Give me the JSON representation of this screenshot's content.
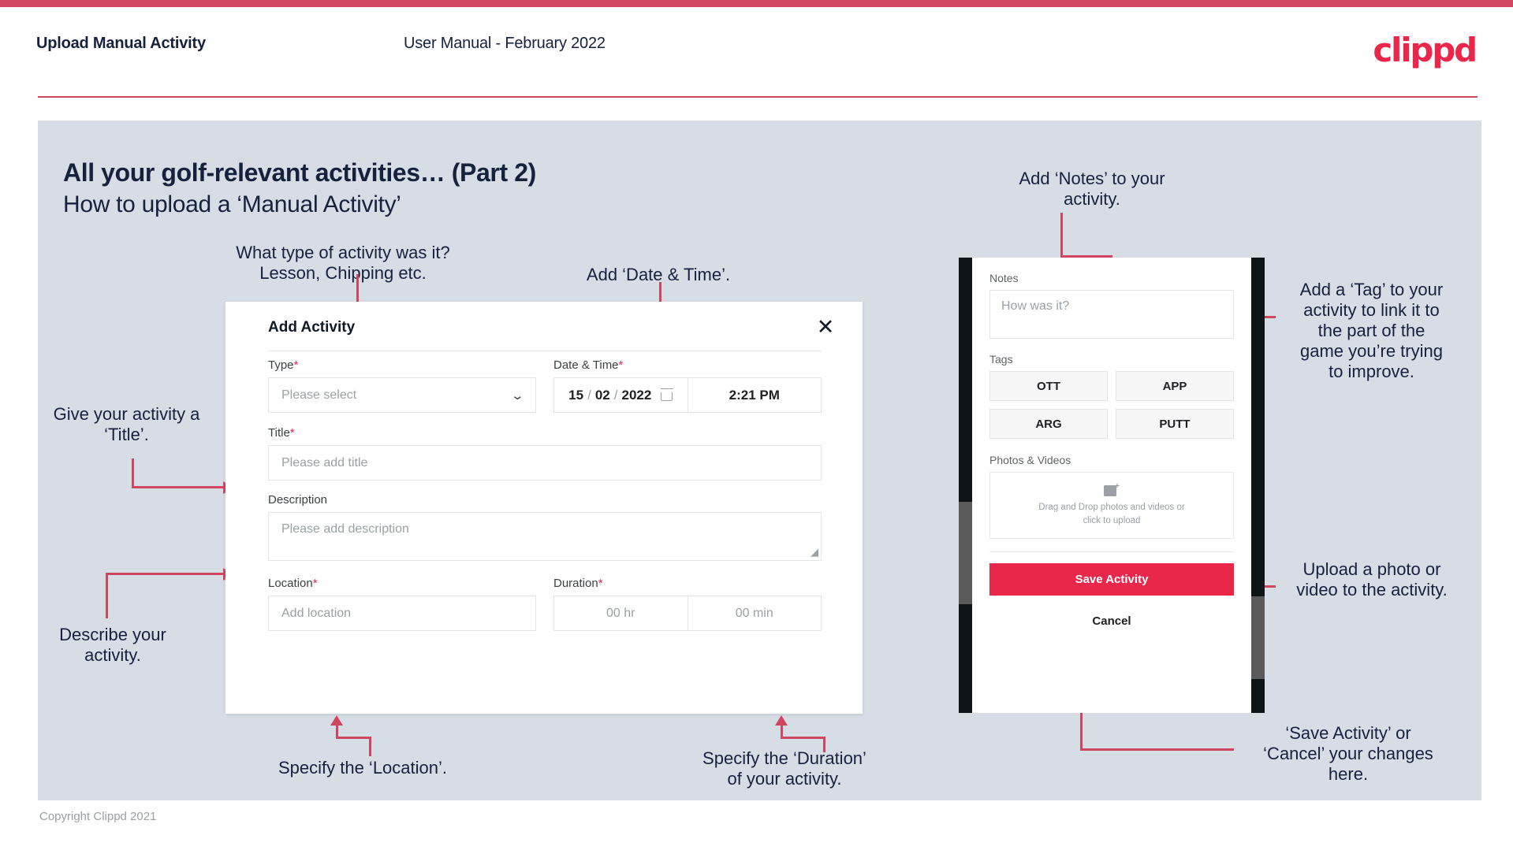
{
  "header": {
    "title": "Upload Manual Activity",
    "subtitle": "User Manual - February 2022",
    "brand": "clippd"
  },
  "slide": {
    "title": "All your golf-relevant activities… (Part 2)",
    "subtitle": "How to upload a ‘Manual Activity’"
  },
  "callouts": {
    "type": "What type of activity was it?\nLesson, Chipping etc.",
    "datetime": "Add ‘Date & Time’.",
    "title": "Give your activity a\n‘Title’.",
    "description": "Describe your\nactivity.",
    "location": "Specify the ‘Location’.",
    "duration": "Specify the ‘Duration’\nof your activity.",
    "notes": "Add ‘Notes’ to your\nactivity.",
    "tags": "Add a ‘Tag’ to your\nactivity to link it to\nthe part of the\ngame you’re trying\nto improve.",
    "upload": "Upload a photo or\nvideo to the activity.",
    "save": "‘Save Activity’ or\n‘Cancel’ your changes\nhere."
  },
  "dialog": {
    "title": "Add Activity",
    "close_icon": "✕",
    "type": {
      "label": "Type",
      "required": "*",
      "placeholder": "Please select",
      "chevron": "⌄"
    },
    "datetime": {
      "label": "Date & Time",
      "required": "*",
      "day": "15",
      "month": "02",
      "year": "2022",
      "sep": "/",
      "time": "2:21 PM"
    },
    "title_field": {
      "label": "Title",
      "required": "*",
      "placeholder": "Please add title"
    },
    "description": {
      "label": "Description",
      "placeholder": "Please add description"
    },
    "location": {
      "label": "Location",
      "required": "*",
      "placeholder": "Add location"
    },
    "duration": {
      "label": "Duration",
      "required": "*",
      "hours": "00 hr",
      "minutes": "00 min"
    }
  },
  "phone": {
    "notes": {
      "label": "Notes",
      "placeholder": "How was it?"
    },
    "tags": {
      "label": "Tags",
      "items": [
        "OTT",
        "APP",
        "ARG",
        "PUTT"
      ]
    },
    "photos": {
      "label": "Photos & Videos",
      "drop_text": "Drag and Drop photos and videos or click to upload"
    },
    "save_label": "Save Activity",
    "cancel_label": "Cancel"
  },
  "footer": {
    "copyright": "Copyright Clippd 2021"
  },
  "colors": {
    "accent": "#e8274b",
    "connector": "#cf4660",
    "panel": "#d7dde5",
    "text_dark": "#16213e"
  }
}
